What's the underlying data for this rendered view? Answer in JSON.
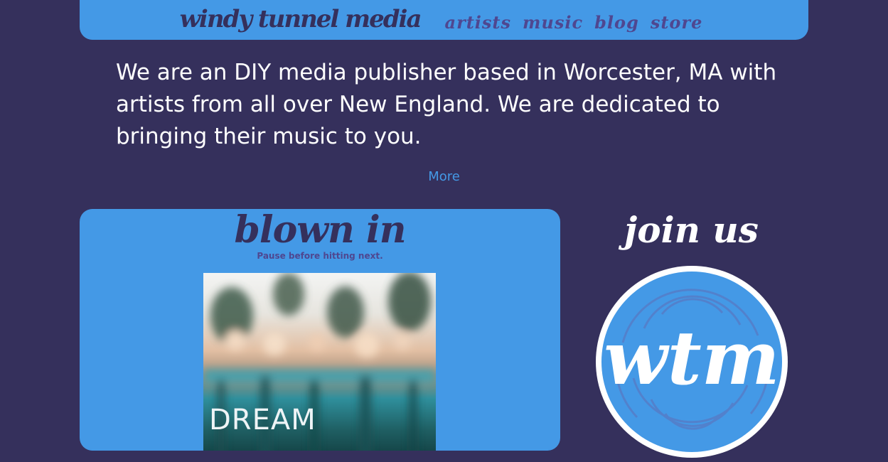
{
  "header": {
    "brand": "windy tunnel media",
    "nav": [
      "artists",
      "music",
      "blog",
      "store"
    ]
  },
  "intro": {
    "text": "We are an DIY media publisher based in Worcester, MA with artists from all over New England. We are dedicated to bringing their music to you.",
    "more_label": "More"
  },
  "feature": {
    "title": "blown in",
    "subtitle": "Pause before hitting next.",
    "album_text": "DREAM"
  },
  "join": {
    "title": "join us",
    "logo_text": "wtm"
  },
  "colors": {
    "background": "#35305c",
    "accent": "#4499e6",
    "nav_text": "#4f4790",
    "white": "#ffffff"
  }
}
